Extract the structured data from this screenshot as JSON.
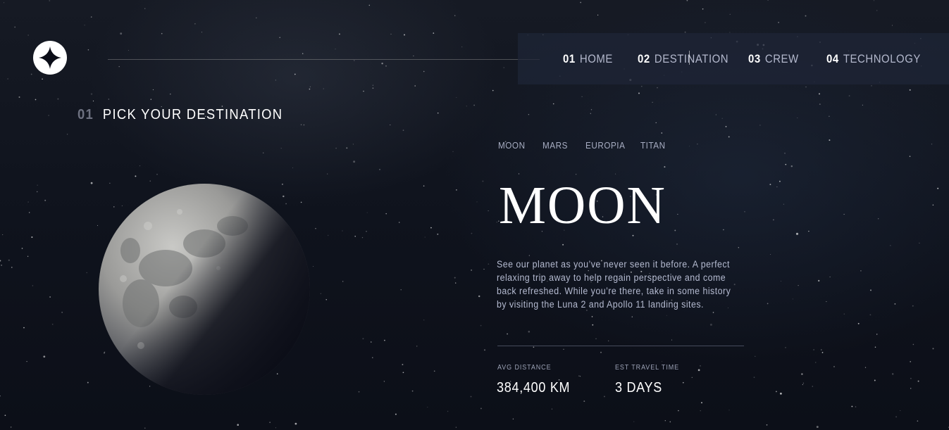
{
  "header": {
    "logo_icon": "four-point-star-icon"
  },
  "nav": {
    "items": [
      {
        "number": "01",
        "label": "HOME"
      },
      {
        "number": "02",
        "label": "DESTINATION",
        "active": true
      },
      {
        "number": "03",
        "label": "CREW"
      },
      {
        "number": "04",
        "label": "TECHNOLOGY"
      }
    ]
  },
  "page": {
    "number": "01",
    "title": "PICK YOUR DESTINATION"
  },
  "destination": {
    "tabs": [
      "MOON",
      "MARS",
      "EUROPIA",
      "TITAN"
    ],
    "selected_tab": "MOON",
    "name": "MOON",
    "description": "See our planet as you’ve never seen it before. A perfect relaxing trip away to help regain perspective and come back refreshed. While you’re there, take in some history by visiting the Luna 2 and Apollo 11 landing sites.",
    "stats": {
      "distance_label": "AVG DISTANCE",
      "distance_value": "384,400 KM",
      "travel_label": "EST TRAVEL TIME",
      "travel_value": "3 DAYS"
    }
  },
  "colors": {
    "background": "#0b0d17",
    "text_light": "#d0d6f9",
    "white": "#ffffff",
    "nav_bg": "#1e2638"
  }
}
